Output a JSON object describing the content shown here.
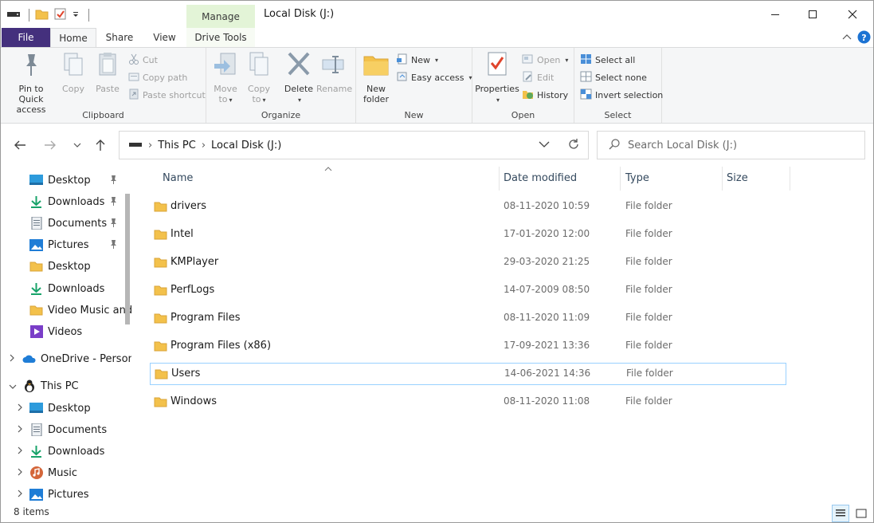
{
  "window": {
    "title": "Local Disk (J:)",
    "context_tab": "Manage"
  },
  "tabs": [
    "File",
    "Home",
    "Share",
    "View",
    "Drive Tools"
  ],
  "ribbon": {
    "clipboard": {
      "label": "Clipboard",
      "pin": "Pin to Quick access",
      "pin_l1": "Pin to Quick",
      "pin_l2": "access",
      "copy": "Copy",
      "paste": "Paste",
      "cut": "Cut",
      "copy_path": "Copy path",
      "paste_shortcut": "Paste shortcut"
    },
    "organize": {
      "label": "Organize",
      "move_l1": "Move",
      "move_l2": "to",
      "copy_l1": "Copy",
      "copy_l2": "to",
      "delete": "Delete",
      "rename": "Rename"
    },
    "new": {
      "label": "New",
      "folder_l1": "New",
      "folder_l2": "folder",
      "new_item": "New",
      "easy_access": "Easy access"
    },
    "open": {
      "label": "Open",
      "properties": "Properties",
      "open": "Open",
      "edit": "Edit",
      "history": "History"
    },
    "select": {
      "label": "Select",
      "select_all": "Select all",
      "select_none": "Select none",
      "invert": "Invert selection"
    }
  },
  "address": {
    "crumbs": [
      "This PC",
      "Local Disk (J:)"
    ],
    "search_placeholder": "Search Local Disk (J:)"
  },
  "nav": {
    "quick": [
      {
        "label": "Desktop",
        "icon": "desktop-icon",
        "pinned": true
      },
      {
        "label": "Downloads",
        "icon": "download-icon",
        "pinned": true
      },
      {
        "label": "Documents",
        "icon": "documents-icon",
        "pinned": true
      },
      {
        "label": "Pictures",
        "icon": "pictures-icon",
        "pinned": true
      },
      {
        "label": "Desktop",
        "icon": "folder-icon",
        "pinned": false
      },
      {
        "label": "Downloads",
        "icon": "download-icon",
        "pinned": false
      },
      {
        "label": "Video Music and",
        "icon": "folder-icon",
        "pinned": false
      },
      {
        "label": "Videos",
        "icon": "videos-icon",
        "pinned": false
      }
    ],
    "onedrive": "OneDrive - Person",
    "thispc": "This PC",
    "pc_children": [
      {
        "label": "Desktop",
        "icon": "desktop-icon"
      },
      {
        "label": "Documents",
        "icon": "documents-icon"
      },
      {
        "label": "Downloads",
        "icon": "download-icon"
      },
      {
        "label": "Music",
        "icon": "music-icon"
      },
      {
        "label": "Pictures",
        "icon": "pictures-icon"
      }
    ]
  },
  "columns": {
    "name": "Name",
    "date": "Date modified",
    "type": "Type",
    "size": "Size"
  },
  "files": [
    {
      "name": "drivers",
      "date": "08-11-2020 10:59",
      "type": "File folder"
    },
    {
      "name": "Intel",
      "date": "17-01-2020 12:00",
      "type": "File folder"
    },
    {
      "name": "KMPlayer",
      "date": "29-03-2020 21:25",
      "type": "File folder"
    },
    {
      "name": "PerfLogs",
      "date": "14-07-2009 08:50",
      "type": "File folder"
    },
    {
      "name": "Program Files",
      "date": "08-11-2020 11:09",
      "type": "File folder"
    },
    {
      "name": "Program Files (x86)",
      "date": "17-09-2021 13:36",
      "type": "File folder"
    },
    {
      "name": "Users",
      "date": "14-06-2021 14:36",
      "type": "File folder",
      "selected": true
    },
    {
      "name": "Windows",
      "date": "08-11-2020 11:08",
      "type": "File folder"
    }
  ],
  "status": {
    "items": "8 items"
  },
  "colors": {
    "file_tab": "#44307d",
    "manage_tab": "#e3f4d7",
    "folder": "#f3c14b",
    "accent": "#0078d7",
    "selection_border": "#99d1ff"
  }
}
